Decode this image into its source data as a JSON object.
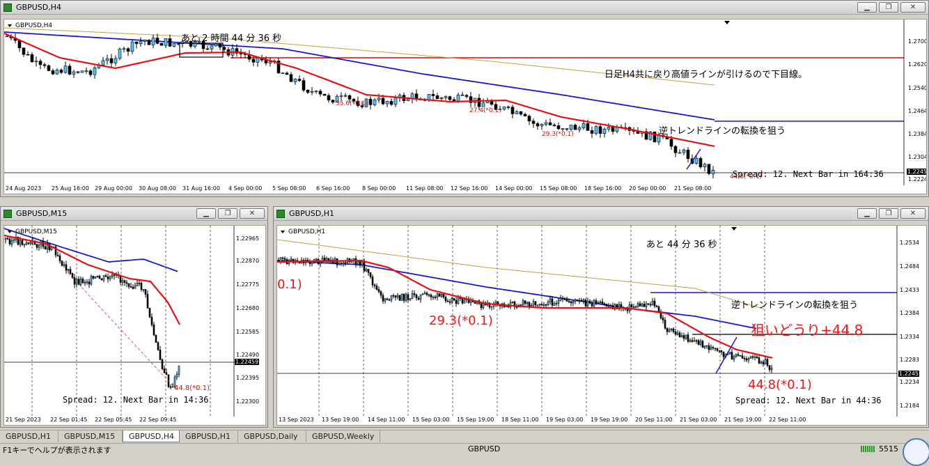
{
  "windows": {
    "h4": {
      "title": "GBPUSD,H4",
      "symbol_label": "GBPUSD,H4",
      "countdown": "あと 2 時間 44 分 36 秒",
      "note_top": "日足H4共に戻り高値ラインが引けるので下目線。",
      "note_mid": "逆トレンドラインの転換を狙う",
      "spread": "Spread: 12. Next Bar in 164:36",
      "bar_labels": [
        "35.6(*0.1)",
        "27.4(*0.1)",
        "29.3(*0.1)",
        "44.8(*0.1)"
      ],
      "y_labels": [
        "1.2700",
        "1.2620",
        "1.2540",
        "1.2464",
        "1.2384",
        "1.2304",
        "1.2245",
        "1.2224"
      ],
      "x_labels": [
        "24 Aug 2023",
        "25 Aug 16:00",
        "29 Aug 00:00",
        "30 Aug 08:00",
        "31 Aug 16:00",
        "4 Sep 00:00",
        "5 Sep 08:00",
        "6 Sep 16:00",
        "8 Sep 00:00",
        "11 Sep 08:00",
        "12 Sep 16:00",
        "14 Sep 00:00",
        "15 Sep 08:00",
        "18 Sep 16:00",
        "20 Sep 00:00",
        "21 Sep 08:00"
      ]
    },
    "m15": {
      "title": "GBPUSD,M15",
      "symbol_label": "GBPUSD,M15",
      "bar_label": "44.8(*0.1)",
      "spread": "Spread: 12. Next Bar in 14:36",
      "y_labels": [
        "1.22965",
        "1.22870",
        "1.22775",
        "1.22680",
        "1.22585",
        "1.22490",
        "1.22459",
        "1.22395",
        "1.22300"
      ],
      "x_labels": [
        "21 Sep 2023",
        "22 Sep 01:45",
        "22 Sep 05:45",
        "22 Sep 09:45"
      ]
    },
    "h1": {
      "title": "GBPUSD,H1",
      "symbol_label": "GBPUSD,H1",
      "countdown": "あと 44 分 36 秒",
      "note_mid": "逆トレンドラインの転換を狙う",
      "note_red": "狙いどうり+44.8",
      "label_left": "0.1)",
      "label_mid": "29.3(*0.1)",
      "label_bottom": "44.8(*0.1)",
      "spread": "Spread: 12. Next Bar in 44:36",
      "y_labels": [
        "1.2534",
        "1.2484",
        "1.2433",
        "1.2384",
        "1.2334",
        "1.2283",
        "1.2245",
        "1.2234",
        "1.2184"
      ],
      "x_labels": [
        "13 Sep 2023",
        "13 Sep 19:00",
        "14 Sep 11:00",
        "15 Sep 03:00",
        "15 Sep 19:00",
        "18 Sep 11:00",
        "19 Sep 03:00",
        "19 Sep 19:00",
        "20 Sep 11:00",
        "21 Sep 03:00",
        "21 Sep 19:00",
        "22 Sep 11:00"
      ]
    }
  },
  "tabs": [
    "GBPUSD,H1",
    "GBPUSD,M15",
    "GBPUSD,H4",
    "GBPUSD,H1",
    "GBPUSD,Daily",
    "GBPUSD,Weekly"
  ],
  "active_tab_index": 2,
  "status": {
    "help": "F1キーでヘルプが表示されます",
    "profile": "GBPUSD",
    "traffic": "5515"
  },
  "colors": {
    "ma_fast": "#e81010",
    "ma_mid": "#1818d0",
    "ma_slow": "#c8a040",
    "resistance": "#e00000",
    "trendline": "#1818d0"
  }
}
